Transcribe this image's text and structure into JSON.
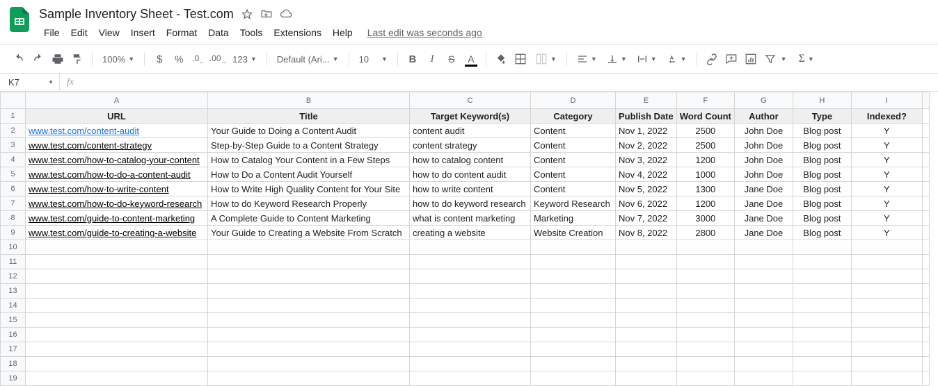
{
  "doc": {
    "title": "Sample Inventory Sheet - Test.com"
  },
  "menu": {
    "file": "File",
    "edit": "Edit",
    "view": "View",
    "insert": "Insert",
    "format": "Format",
    "data": "Data",
    "tools": "Tools",
    "extensions": "Extensions",
    "help": "Help",
    "last_edit": "Last edit was seconds ago"
  },
  "toolbar": {
    "zoom": "100%",
    "font": "Default (Ari...",
    "font_size": "10"
  },
  "namebox": {
    "ref": "K7"
  },
  "columns": [
    "A",
    "B",
    "C",
    "D",
    "E",
    "F",
    "G",
    "H",
    "I"
  ],
  "headers": [
    "URL",
    "Title",
    "Target Keyword(s)",
    "Category",
    "Publish Date",
    "Word Count",
    "Author",
    "Type",
    "Indexed?"
  ],
  "rows": [
    {
      "url": "www.test.com/content-audit",
      "title": "Your Guide to Doing a Content Audit",
      "kw": "content audit",
      "cat": "Content",
      "date": "Nov 1, 2022",
      "wc": "2500",
      "author": "John Doe",
      "type": "Blog post",
      "idx": "Y",
      "active": true
    },
    {
      "url": "www.test.com/content-strategy",
      "title": "Step-by-Step Guide to a Content Strategy",
      "kw": "content strategy",
      "cat": "Content",
      "date": "Nov 2, 2022",
      "wc": "2500",
      "author": "John Doe",
      "type": "Blog post",
      "idx": "Y"
    },
    {
      "url": "www.test.com/how-to-catalog-your-content",
      "title": "How to Catalog Your Content in a Few Steps",
      "kw": "how to catalog content",
      "cat": "Content",
      "date": "Nov 3, 2022",
      "wc": "1200",
      "author": "John Doe",
      "type": "Blog post",
      "idx": "Y"
    },
    {
      "url": "www.test.com/how-to-do-a-content-audit",
      "title": "How to Do a Content Audit Yourself",
      "kw": "how to do content audit",
      "cat": "Content",
      "date": "Nov 4, 2022",
      "wc": "1000",
      "author": "John Doe",
      "type": "Blog post",
      "idx": "Y"
    },
    {
      "url": "www.test.com/how-to-write-content",
      "title": "How to Write High Quality Content for Your Site",
      "kw": "how to write content",
      "cat": "Content",
      "date": "Nov 5, 2022",
      "wc": "1300",
      "author": "Jane Doe",
      "type": "Blog post",
      "idx": "Y"
    },
    {
      "url": "www.test.com/how-to-do-keyword-research",
      "title": "How to do Keyword Research Properly",
      "kw": "how to do keyword research",
      "cat": "Keyword Research",
      "date": "Nov 6, 2022",
      "wc": "1200",
      "author": "Jane Doe",
      "type": "Blog post",
      "idx": "Y"
    },
    {
      "url": "www.test.com/guide-to-content-marketing",
      "title": "A Complete Guide to Content Marketing",
      "kw": "what is content marketing",
      "cat": "Marketing",
      "date": "Nov 7, 2022",
      "wc": "3000",
      "author": "Jane Doe",
      "type": "Blog post",
      "idx": "Y"
    },
    {
      "url": "www.test.com/guide-to-creating-a-website",
      "title": "Your Guide to Creating a Website From Scratch",
      "kw": "creating a website",
      "cat": "Website Creation",
      "date": "Nov 8, 2022",
      "wc": "2800",
      "author": "Jane Doe",
      "type": "Blog post",
      "idx": "Y"
    }
  ],
  "empty_rows": 10
}
